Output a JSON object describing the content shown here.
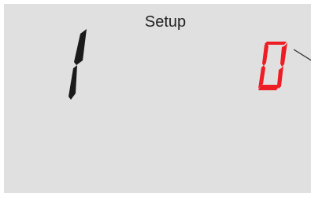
{
  "header": {
    "title": "Setup"
  },
  "display": {
    "left_digit": "1",
    "right_digit": "0",
    "left_digit_color": "#1a1a1a",
    "right_digit_color": "#ee1c24"
  },
  "colors": {
    "screen_background": "#e0e0e0",
    "title_text": "#222222"
  }
}
